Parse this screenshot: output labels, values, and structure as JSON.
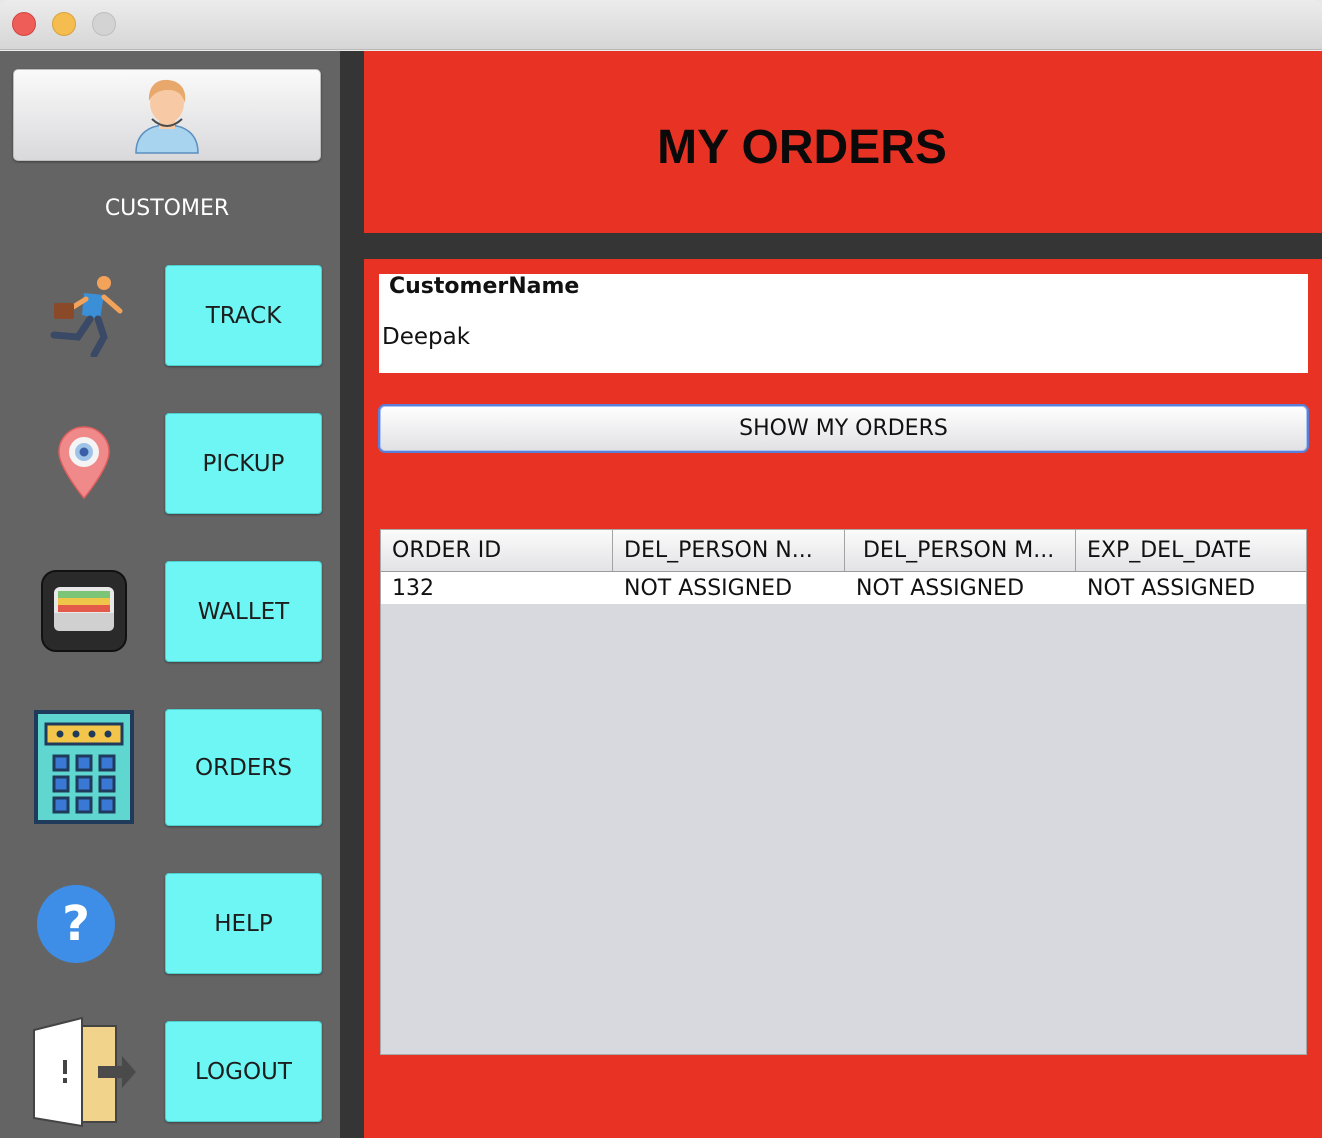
{
  "window": {
    "controls": [
      "close",
      "minimize",
      "maximize"
    ]
  },
  "sidebar": {
    "role": "CUSTOMER",
    "avatar_icon": "user-avatar-icon",
    "items": [
      {
        "label": "TRACK",
        "icon": "running-courier-icon"
      },
      {
        "label": "PICKUP",
        "icon": "location-pin-icon"
      },
      {
        "label": "WALLET",
        "icon": "wallet-icon"
      },
      {
        "label": "ORDERS",
        "icon": "calculator-icon"
      },
      {
        "label": "HELP",
        "icon": "question-icon"
      },
      {
        "label": "LOGOUT",
        "icon": "exit-door-icon"
      }
    ]
  },
  "header": {
    "title": "MY ORDERS"
  },
  "customer": {
    "label": "CustomerName",
    "value": "Deepak"
  },
  "actions": {
    "show_orders": "SHOW MY ORDERS"
  },
  "orders_table": {
    "columns": [
      "ORDER ID",
      "DEL_PERSON N...",
      " DEL_PERSON M...",
      "EXP_DEL_DATE"
    ],
    "rows": [
      [
        "132",
        "NOT ASSIGNED",
        "NOT ASSIGNED",
        "NOT ASSIGNED"
      ]
    ]
  },
  "colors": {
    "accent_red": "#e83324",
    "button_cyan": "#6ef6f4",
    "sidebar_gray": "#646464",
    "divider_dark": "#353535"
  }
}
